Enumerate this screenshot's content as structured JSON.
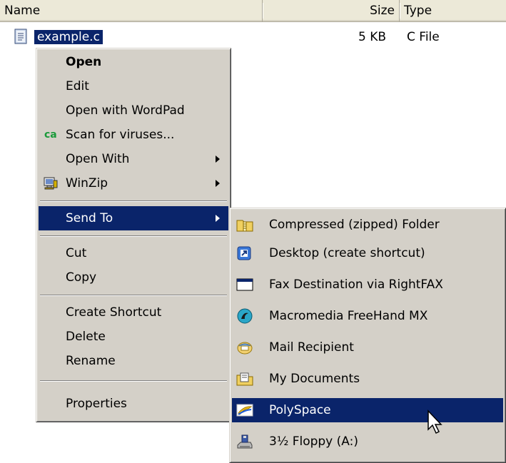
{
  "columns": {
    "name": "Name",
    "size": "Size",
    "type": "Type"
  },
  "file": {
    "name": "example.c",
    "size": "5 KB",
    "type": "C File"
  },
  "context_menu": {
    "open": "Open",
    "edit": "Edit",
    "open_wordpad": "Open with WordPad",
    "scan_badge": "ca",
    "scan": "Scan for viruses...",
    "open_with": "Open With",
    "winzip": "WinZip",
    "send_to": "Send To",
    "cut": "Cut",
    "copy": "Copy",
    "create_shortcut": "Create Shortcut",
    "delete": "Delete",
    "rename": "Rename",
    "properties": "Properties"
  },
  "send_to_menu": {
    "compressed": "Compressed (zipped) Folder",
    "desktop": "Desktop (create shortcut)",
    "fax": "Fax Destination via RightFAX",
    "freehand": "Macromedia FreeHand MX",
    "mail": "Mail Recipient",
    "documents": "My Documents",
    "polyspace": "PolySpace",
    "floppy": "3½ Floppy (A:)"
  },
  "colors": {
    "selection": "#0a246a",
    "menu_face": "#d4d0c8",
    "header_face": "#ece9d8"
  }
}
